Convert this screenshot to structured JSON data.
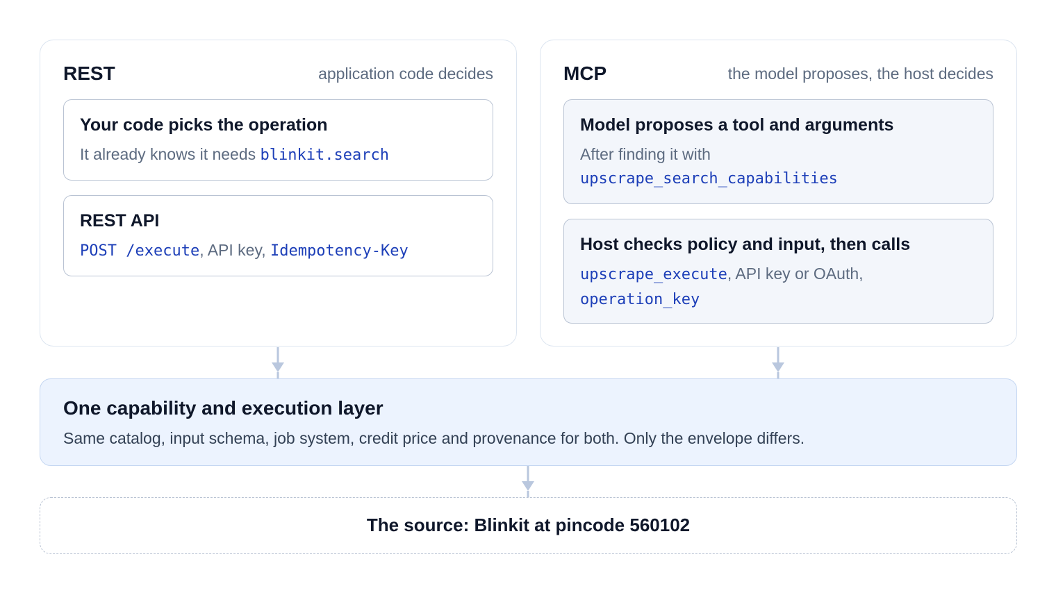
{
  "rest": {
    "title": "REST",
    "caption": "application code decides",
    "card1": {
      "title": "Your code picks the operation",
      "text": "It already knows it needs ",
      "code": "blinkit.search"
    },
    "card2": {
      "title": "REST API",
      "code1": "POST /execute",
      "text1": ", API key, ",
      "code2": "Idempotency-Key"
    }
  },
  "mcp": {
    "title": "MCP",
    "caption": "the model proposes, the host decides",
    "card1": {
      "title": "Model proposes a tool and arguments",
      "text": "After finding it with",
      "code": "upscrape_search_capabilities"
    },
    "card2": {
      "title": "Host checks policy and input, then calls",
      "code1": "upscrape_execute",
      "text1": ", API key or OAuth,",
      "code2": "operation_key"
    }
  },
  "layer": {
    "title": "One capability and execution layer",
    "description": "Same catalog, input schema, job system, credit price and provenance for both. Only the envelope differs."
  },
  "source": {
    "label": "The source: Blinkit at pincode 560102"
  },
  "colors": {
    "code": "#1d3fb8",
    "arrow": "#b9c7de",
    "layer_bg": "#ecf3fe",
    "mcp_card_bg": "#f3f6fb"
  }
}
